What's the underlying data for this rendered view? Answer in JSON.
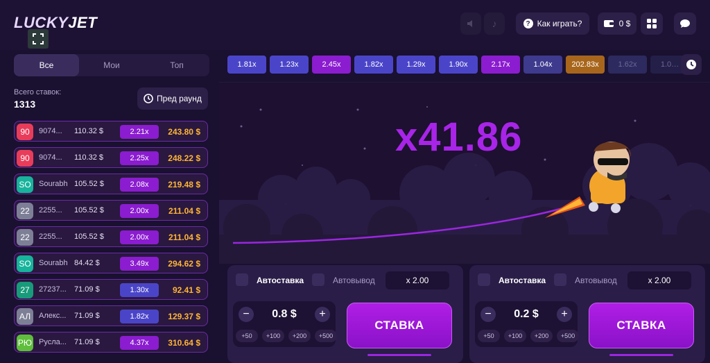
{
  "header": {
    "logo_part1": "LUCKY",
    "logo_part2": "JET",
    "how_to_play": "Как играть?",
    "balance": "0 $"
  },
  "left": {
    "tabs": [
      "Все",
      "Мои",
      "Топ"
    ],
    "total_label": "Всего ставок:",
    "total_value": "1313",
    "prev_round": "Пред раунд",
    "bets": [
      {
        "avatar": "90",
        "avatar_color": "#e83c5a",
        "name": "9074...",
        "amount": "110.32 $",
        "mult": "2.21x",
        "mult_color": "#8b1ccf",
        "win": "243.80 $"
      },
      {
        "avatar": "90",
        "avatar_color": "#e83c5a",
        "name": "9074...",
        "amount": "110.32 $",
        "mult": "2.25x",
        "mult_color": "#8b1ccf",
        "win": "248.22 $"
      },
      {
        "avatar": "SO",
        "avatar_color": "#17b39c",
        "name": "Sourabh",
        "amount": "105.52 $",
        "mult": "2.08x",
        "mult_color": "#8b1ccf",
        "win": "219.48 $"
      },
      {
        "avatar": "22",
        "avatar_color": "#7d7f96",
        "name": "2255...",
        "amount": "105.52 $",
        "mult": "2.00x",
        "mult_color": "#8b1ccf",
        "win": "211.04 $"
      },
      {
        "avatar": "22",
        "avatar_color": "#7d7f96",
        "name": "2255...",
        "amount": "105.52 $",
        "mult": "2.00x",
        "mult_color": "#8b1ccf",
        "win": "211.04 $"
      },
      {
        "avatar": "SO",
        "avatar_color": "#17b39c",
        "name": "Sourabh",
        "amount": "84.42 $",
        "mult": "3.49x",
        "mult_color": "#8b1ccf",
        "win": "294.62 $"
      },
      {
        "avatar": "27",
        "avatar_color": "#189b7a",
        "name": "27237...",
        "amount": "71.09 $",
        "mult": "1.30x",
        "mult_color": "#4a45c8",
        "win": "92.41 $"
      },
      {
        "avatar": "АЛ",
        "avatar_color": "#7d7f96",
        "name": "Алекс...",
        "amount": "71.09 $",
        "mult": "1.82x",
        "mult_color": "#4a45c8",
        "win": "129.37 $"
      },
      {
        "avatar": "РЮ",
        "avatar_color": "#5fbf3c",
        "name": "Русла...",
        "amount": "71.09 $",
        "mult": "4.37x",
        "mult_color": "#8b1ccf",
        "win": "310.64 $"
      }
    ]
  },
  "history": [
    {
      "value": "1.81x",
      "color": "#4a45c8"
    },
    {
      "value": "1.23x",
      "color": "#4a45c8"
    },
    {
      "value": "2.45x",
      "color": "#8b1ccf"
    },
    {
      "value": "1.82x",
      "color": "#4a45c8"
    },
    {
      "value": "1.29x",
      "color": "#4a45c8"
    },
    {
      "value": "1.90x",
      "color": "#4a45c8"
    },
    {
      "value": "2.17x",
      "color": "#8b1ccf"
    },
    {
      "value": "1.04x",
      "color": "#3e3a8e"
    },
    {
      "value": "202.83x",
      "color": "#a8661c"
    },
    {
      "value": "1.62x",
      "color": "#2c2a5e"
    },
    {
      "value": "1.0…",
      "color": "#231f48"
    }
  ],
  "game": {
    "multiplier": "x41.86"
  },
  "panels": [
    {
      "autobet": "Автоставка",
      "autocashout": "Автовывод",
      "cashout_value": "x 2.00",
      "amount": "0.8 $",
      "quick": [
        "+50",
        "+100",
        "+200",
        "+500"
      ],
      "stake": "СТАВКА"
    },
    {
      "autobet": "Автоставка",
      "autocashout": "Автовывод",
      "cashout_value": "x 2.00",
      "amount": "0.2 $",
      "quick": [
        "+50",
        "+100",
        "+200",
        "+500"
      ],
      "stake": "СТАВКА"
    }
  ],
  "colors": {
    "background": "#1a1030",
    "accent": "#a824e8",
    "win": "#ffb535"
  }
}
